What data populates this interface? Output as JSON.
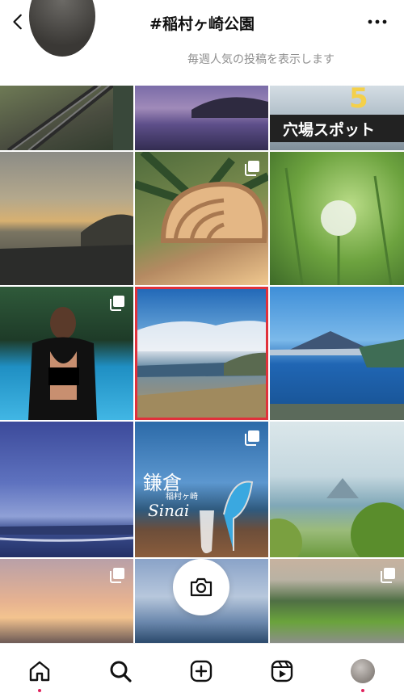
{
  "header": {
    "title": "#稲村ヶ崎公園"
  },
  "subline": "毎週人気の投稿を表示します",
  "tiles": {
    "t3_text1": "穴場スポット",
    "t3_text2": "5",
    "t8_text1": "鎌倉",
    "t8_text2": "稲村ヶ崎",
    "t8_text3": "Sinai"
  },
  "colors": {
    "accent": "#e0245e",
    "highlight": "#e0313b"
  },
  "icons": [
    "chevron-left-icon",
    "more-icon",
    "home-icon",
    "search-icon",
    "add-icon",
    "reels-icon",
    "camera-icon",
    "multiple-posts-icon"
  ]
}
